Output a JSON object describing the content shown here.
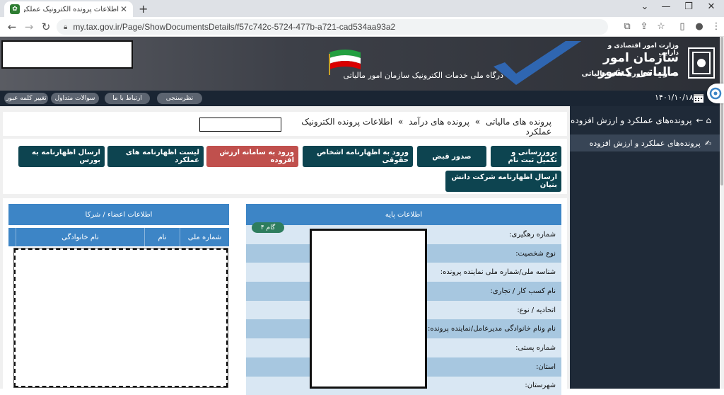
{
  "browser": {
    "tab_title": "اطلاعات پرونده الکترونیک عملکرد: ...",
    "url": "my.tax.gov.ir/Page/ShowDocumentsDetails/f57c742c-5724-477b-a721-cad534aa93a2"
  },
  "header": {
    "ministry": "وزارت امور اقتصادی و دارایی",
    "org_name": "سازمان امور مالیاتی کشور",
    "deputy": "معاونت فناوری های مالیاتی",
    "portal": "درگاه ملی خدمات الکترونیک سازمان امور مالیاتی",
    "colors": {
      "banner": "#3d4048",
      "navbar": "#1a2533",
      "button": "#0d4450",
      "panel": "#3d85c6",
      "danger": "#c0504d"
    }
  },
  "navbar": {
    "links": [
      "تغییر کلمه عبور",
      "سوالات متداول",
      "ارتباط با ما",
      "نظرسنجی"
    ],
    "date": "۱۴۰۱/۱۰/۱۸"
  },
  "sidebar": {
    "heading": "پرونده‌های عملکرد و ارزش افزوده",
    "items": [
      {
        "label": "پرونده‌های عملکرد و ارزش افزوده",
        "icon": "hand-document-icon"
      }
    ]
  },
  "breadcrumb": {
    "items": [
      "پرونده های مالیاتی",
      "پرونده های درآمد",
      "اطلاعات پرونده الکترونیک عملکرد"
    ],
    "separator": "»"
  },
  "actions": {
    "row1": [
      "بروزرسانی و تکمیل ثبت نام",
      "صدور قبض",
      "ورود به اظهارنامه اشخاص حقوقی",
      "ورود به سامانه ارزش افزوده",
      "لیست اظهارنامه های عملکرد",
      "ارسال اظهارنامه به بورس"
    ],
    "row2": [
      "ارسال اظهارنامه شرکت دانش بنیان"
    ]
  },
  "basic_info": {
    "title": "اطلاعات پایه",
    "step": "گام ۴",
    "fields": [
      "شماره رهگیری:",
      "نوع شخصیت:",
      "شناسه ملی/شماره ملی نماینده پرونده:",
      "نام کسب کار / تجاری:",
      "اتحادیه / نوع:",
      "نام ونام خانوادگی مدیرعامل/نماینده پرونده:",
      "شماره پستی:",
      "استان:",
      "شهرستان:"
    ]
  },
  "members": {
    "title": "اطلاعات اعضاء / شرکا",
    "columns": [
      "شماره ملی",
      "نام",
      "نام خانوادگی"
    ]
  }
}
